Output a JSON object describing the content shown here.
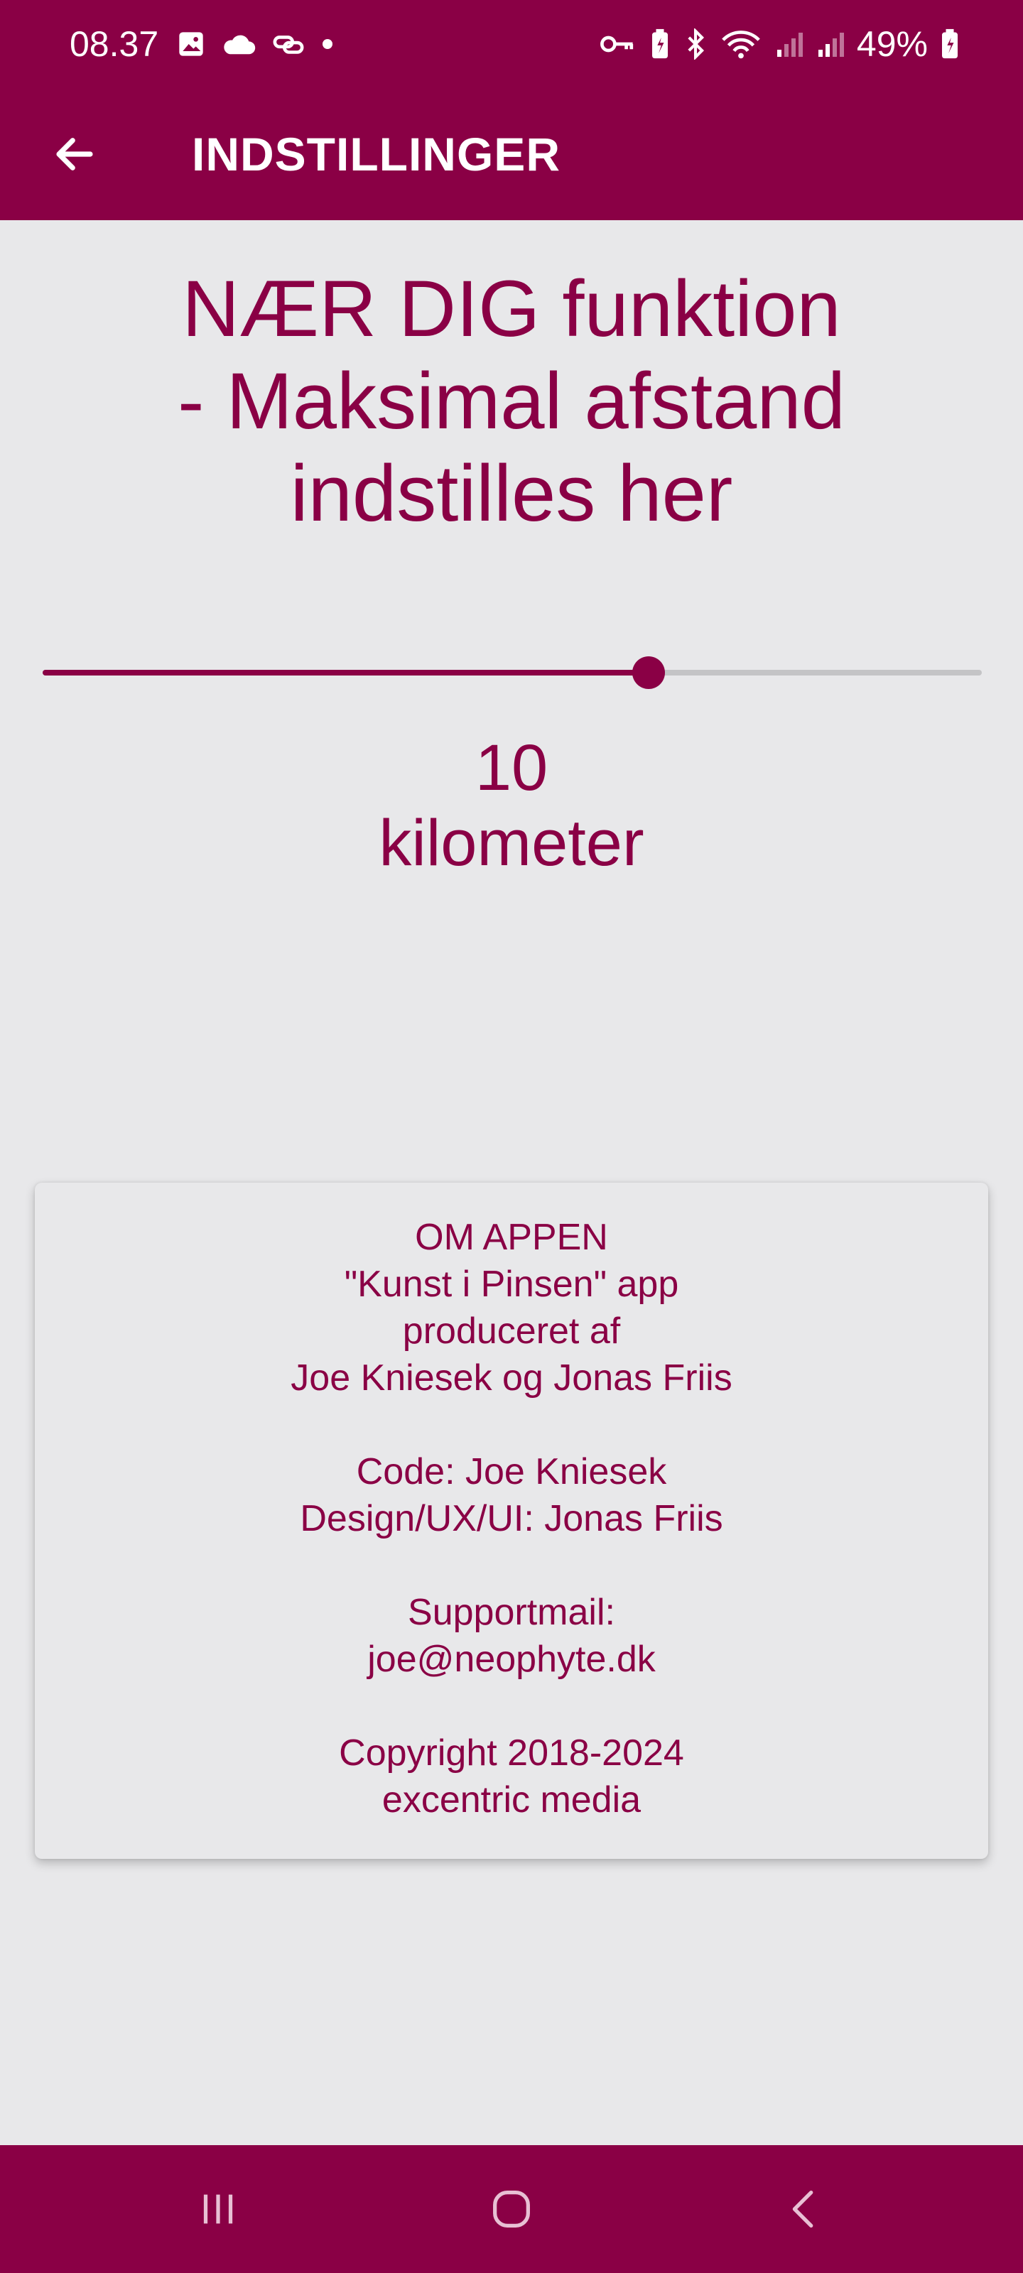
{
  "status_bar": {
    "time": "08.37",
    "battery": "49%",
    "left_icons": [
      "image-icon",
      "cloud-icon",
      "link-icon",
      "dot-icon"
    ],
    "right_icons": [
      "vpn-key-icon",
      "battery-saver-icon",
      "bluetooth-icon",
      "wifi-icon",
      "signal-icon",
      "signal-icon",
      "battery-icon"
    ]
  },
  "app_bar": {
    "title": "INDSTILLINGER",
    "back_icon": "arrow-back-icon"
  },
  "settings": {
    "heading_lines": [
      "NÆR DIG funktion",
      "- Maksimal afstand",
      "indstilles her"
    ],
    "slider_fraction": 0.645,
    "distance_value": "10",
    "distance_unit": "kilometer"
  },
  "about": {
    "title": "OM APPEN",
    "line1": "\"Kunst i Pinsen\" app",
    "line2": "produceret af",
    "line3": "Joe Kniesek og Jonas Friis",
    "code": "Code: Joe Kniesek",
    "design": "Design/UX/UI: Jonas Friis",
    "support_label": "Supportmail:",
    "support_email": "joe@neophyte.dk",
    "copyright": "Copyright 2018-2024",
    "company": "excentric media"
  },
  "nav_bar": {
    "icons": [
      "recent-apps-icon",
      "home-icon",
      "back-icon"
    ]
  },
  "colors": {
    "brand": "#8a0045",
    "background": "#e8e8ea",
    "track": "#c4c4c6"
  }
}
